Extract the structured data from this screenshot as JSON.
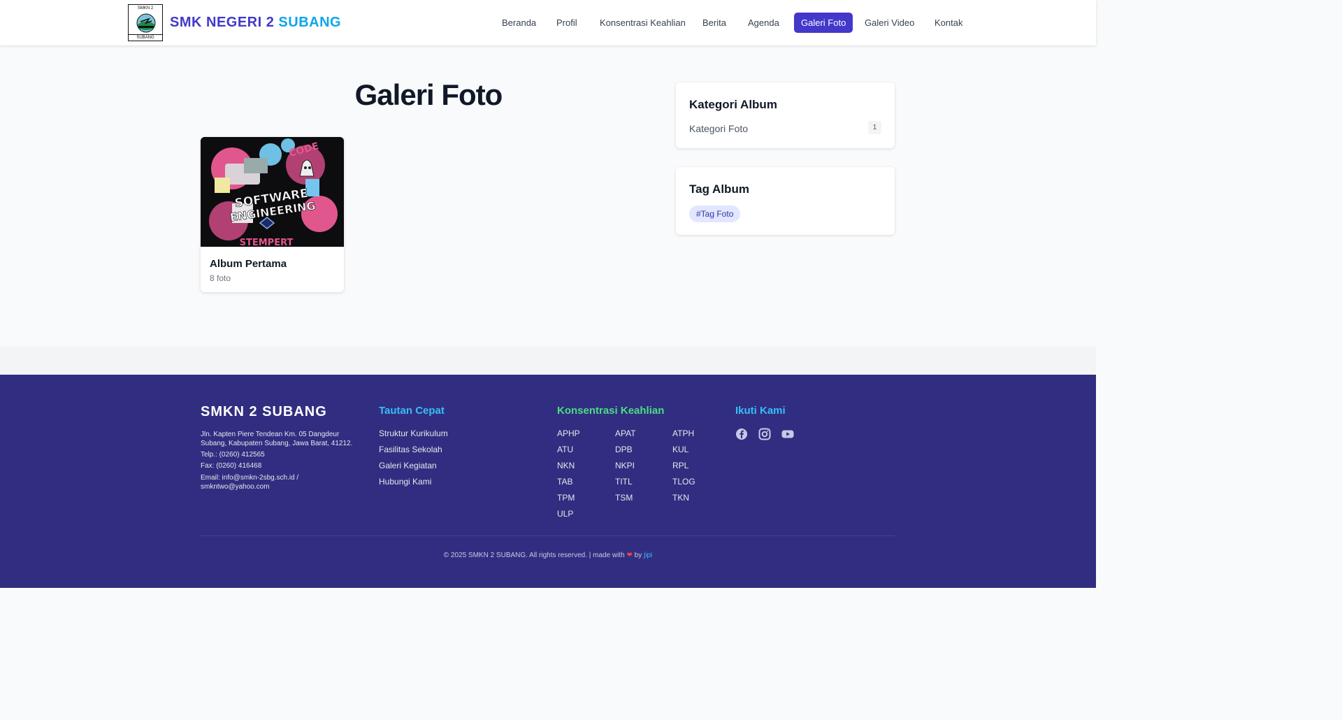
{
  "header": {
    "logo": {
      "top_text": "SMKN 2",
      "bottom_text": "SUBANG"
    },
    "brand_part1": "SMK NEGERI 2",
    "brand_part2": "SUBANG",
    "nav": [
      {
        "label": "Beranda",
        "active": false
      },
      {
        "label": "Profil",
        "active": false
      },
      {
        "label": "Konsentrasi Keahlian",
        "active": false
      },
      {
        "label": "Berita",
        "active": false
      },
      {
        "label": "Agenda",
        "active": false
      },
      {
        "label": "Galeri Foto",
        "active": true
      },
      {
        "label": "Galeri Video",
        "active": false
      },
      {
        "label": "Kontak",
        "active": false
      }
    ],
    "accent_color": "#4338ca"
  },
  "main": {
    "title": "Galeri Foto",
    "albums": [
      {
        "title": "Album Pertama",
        "count": "8 foto"
      }
    ]
  },
  "sidebar": {
    "categories": {
      "title": "Kategori Album",
      "items": [
        {
          "name": "Kategori Foto",
          "count": "1"
        }
      ]
    },
    "tags": {
      "title": "Tag Album",
      "items": [
        "#Tag Foto"
      ]
    }
  },
  "footer": {
    "school_name": "SMKN 2 SUBANG",
    "address": "Jln. Kapten Piere Tendean Km. 05 Dangdeur Subang, Kabupaten Subang, Jawa Barat, 41212.",
    "phone": "Telp.: (0260) 412565",
    "fax": "Fax: (0260) 416468",
    "email": "Email: info@smkn-2sbg.sch.id / smkntwo@yahoo.com",
    "quick_links": {
      "title": "Tautan Cepat",
      "items": [
        "Struktur Kurikulum",
        "Fasilitas Sekolah",
        "Galeri Kegiatan",
        "Hubungi Kami"
      ]
    },
    "expertise": {
      "title": "Konsentrasi Keahlian",
      "items": [
        "APHP",
        "APAT",
        "ATPH",
        "ATU",
        "DPB",
        "KUL",
        "NKN",
        "NKPI",
        "RPL",
        "TAB",
        "TITL",
        "TLOG",
        "TPM",
        "TSM",
        "TKN",
        "ULP"
      ]
    },
    "follow": {
      "title": "Ikuti Kami",
      "icons": [
        "facebook-icon",
        "instagram-icon",
        "youtube-icon"
      ]
    },
    "copyright": "© 2025 SMKN 2 SUBANG. All rights reserved. | made with",
    "by_text": "by",
    "author": "jipi",
    "colors": {
      "background": "#312e81",
      "quick_title": "#38bdf8",
      "expertise_title": "#4ade80",
      "follow_title": "#38bdf8"
    }
  }
}
